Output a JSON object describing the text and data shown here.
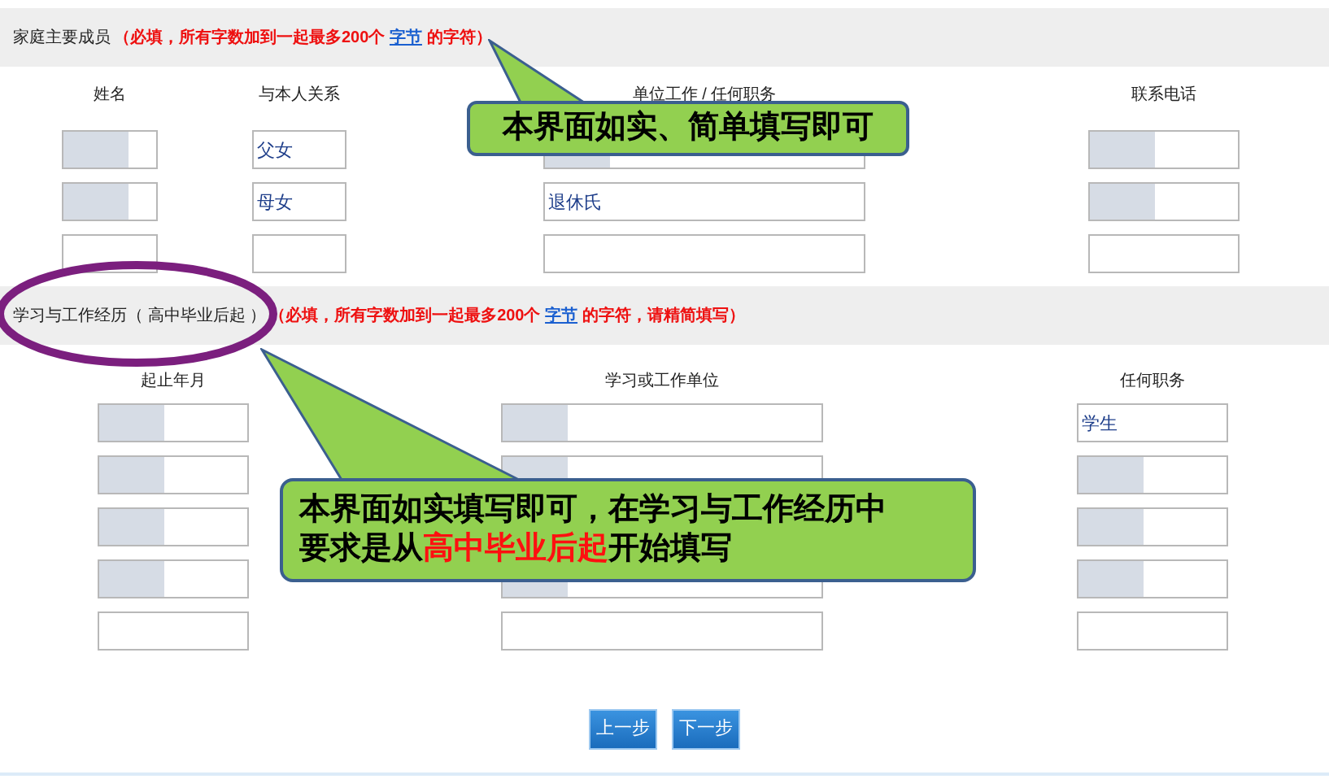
{
  "sections": [
    {
      "title": "家庭主要成员",
      "note": "（必填，所有字数加到一起最多200个",
      "link": "字节",
      "note_end": "的字符）",
      "columns": [
        "姓名",
        "与本人关系",
        "单位工作 / 任何职务",
        "联系电话"
      ],
      "rows": [
        [
          {
            "blurred": true
          },
          {
            "value": "父女",
            "blurred": false
          },
          {
            "blurred": true
          },
          {
            "blurred": true
          }
        ],
        [
          {
            "blurred": true
          },
          {
            "value": "母女",
            "blurred": false
          },
          {
            "value": "退休氏",
            "blurred": false
          },
          {
            "blurred": true
          }
        ],
        [
          {
            "blurred": false
          },
          {
            "blurred": false
          },
          {
            "blurred": false
          },
          {
            "blurred": false
          }
        ]
      ]
    },
    {
      "title": "学习与工作经历（ 高中毕业后起 ）",
      "note": "（必填，所有字数加到一起最多200个",
      "link": "字节",
      "note_end": "的字符，请精简填写）",
      "columns": [
        "起止年月",
        "学习或工作单位",
        "任何职务"
      ],
      "rows": [
        [
          {
            "blurred": true
          },
          {
            "blurred": true
          },
          {
            "value": "学生",
            "blurred": false
          }
        ],
        [
          {
            "blurred": true
          },
          {
            "blurred": true
          },
          {
            "blurred": true
          }
        ],
        [
          {
            "blurred": true
          },
          {},
          {
            "blurred": true
          }
        ],
        [
          {
            "blurred": true
          },
          {
            "blurred": true
          },
          {
            "blurred": true
          }
        ],
        [
          {
            "blurred": false
          },
          {
            "blurred": false
          },
          {
            "blurred": false
          }
        ]
      ]
    }
  ],
  "buttons": [
    "上一步",
    "下一步"
  ],
  "callouts": [
    {
      "lines": [
        [
          {
            "text": "本界面如实、简单填写即可",
            "highlight": false
          }
        ]
      ]
    },
    {
      "lines": [
        [
          {
            "text": "本界面如实填写即可，在学习与工作经历中",
            "highlight": false
          }
        ],
        [
          {
            "text": "要求是从",
            "highlight": false
          },
          {
            "text": "高中毕业后起",
            "highlight": true
          },
          {
            "text": "开始填写",
            "highlight": false
          }
        ]
      ]
    }
  ]
}
